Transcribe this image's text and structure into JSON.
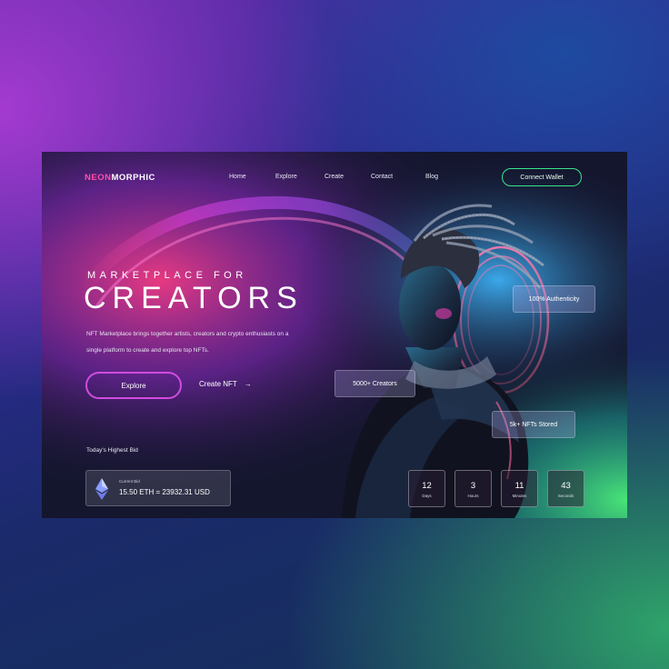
{
  "brand": {
    "neon": "NEON",
    "rest": "MORPHIC"
  },
  "nav": {
    "items": [
      "Home",
      "Explore",
      "Create",
      "Contact",
      "Blog"
    ],
    "wallet_label": "Connect Wallet"
  },
  "hero": {
    "kicker": "MARKETPLACE FOR",
    "title": "CREATORS",
    "description": "NFT Marketplace brings together artists, creators and crypto enthusiasts on a single platform to create and explore top NFTs.",
    "explore_label": "Explore",
    "create_label": "Create NFT",
    "create_arrow": "→"
  },
  "bid": {
    "heading": "Today's Highest Bid",
    "card_label": "Current Bid",
    "card_value": "15.50 ETH = 23932.31 USD",
    "icon": "ethereum-icon"
  },
  "stats": {
    "authenticity": "100% Authenticity",
    "creators": "5000+ Creators",
    "nfts": "5k+ NFTs Stored"
  },
  "countdown": [
    {
      "value": "12",
      "unit": "Days"
    },
    {
      "value": "3",
      "unit": "Hours"
    },
    {
      "value": "11",
      "unit": "Minutes"
    },
    {
      "value": "43",
      "unit": "Seconds"
    }
  ],
  "colors": {
    "accent_pink": "#ff4fa8",
    "accent_purple": "#d04ce0",
    "accent_green": "#38e48c"
  }
}
